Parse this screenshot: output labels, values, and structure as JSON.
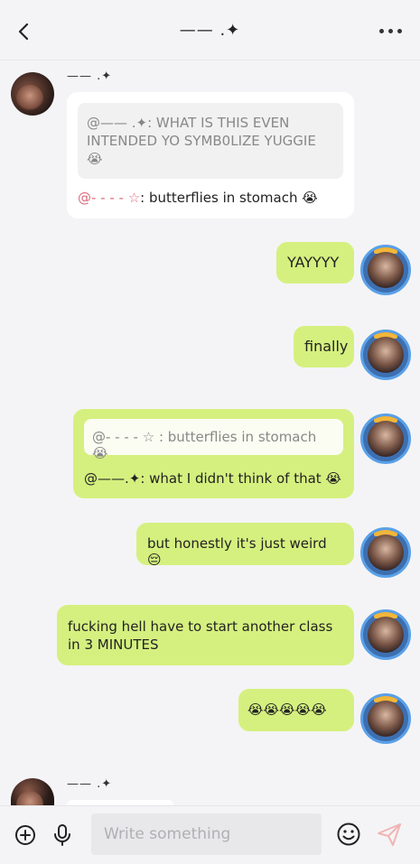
{
  "header": {
    "title": "—— .✦",
    "back_icon": "chevron-left-icon",
    "more_icon": "more-horizontal-icon"
  },
  "messages": {
    "m1": {
      "sender": "—— .✦",
      "quote": "@—— .✦: WHAT IS THIS EVEN INTENDED YO SYMB0LIZE YUGGIE 😭",
      "mention": "@- - - - ☆",
      "text": ": butterflies in stomach 😭"
    },
    "m2": {
      "text": "YAYYYY"
    },
    "m3": {
      "text": "finally"
    },
    "m4": {
      "quote": "@- - - - ☆ : butterflies in stomach 😭",
      "text": "@——.✦: what I didn't think of that 😭"
    },
    "m5": {
      "text": "but honestly it's just weird 😔"
    },
    "m6": {
      "text": "fucking hell have to start another class in 3 MINUTES"
    },
    "m7": {
      "text": "😭😭😭😭😭"
    },
    "m8": {
      "sender": "—— .✦"
    }
  },
  "composer": {
    "placeholder": "Write something",
    "add_icon": "plus-circle-icon",
    "mic_icon": "microphone-icon",
    "emoji_icon": "emoji-icon",
    "send_icon": "send-icon"
  },
  "colors": {
    "background": "#f4f4f6",
    "sent_bubble": "#d5f07f",
    "received_bubble": "#ffffff",
    "mention_pink": "#d96a7c",
    "send_disabled": "#f2b4b4"
  }
}
